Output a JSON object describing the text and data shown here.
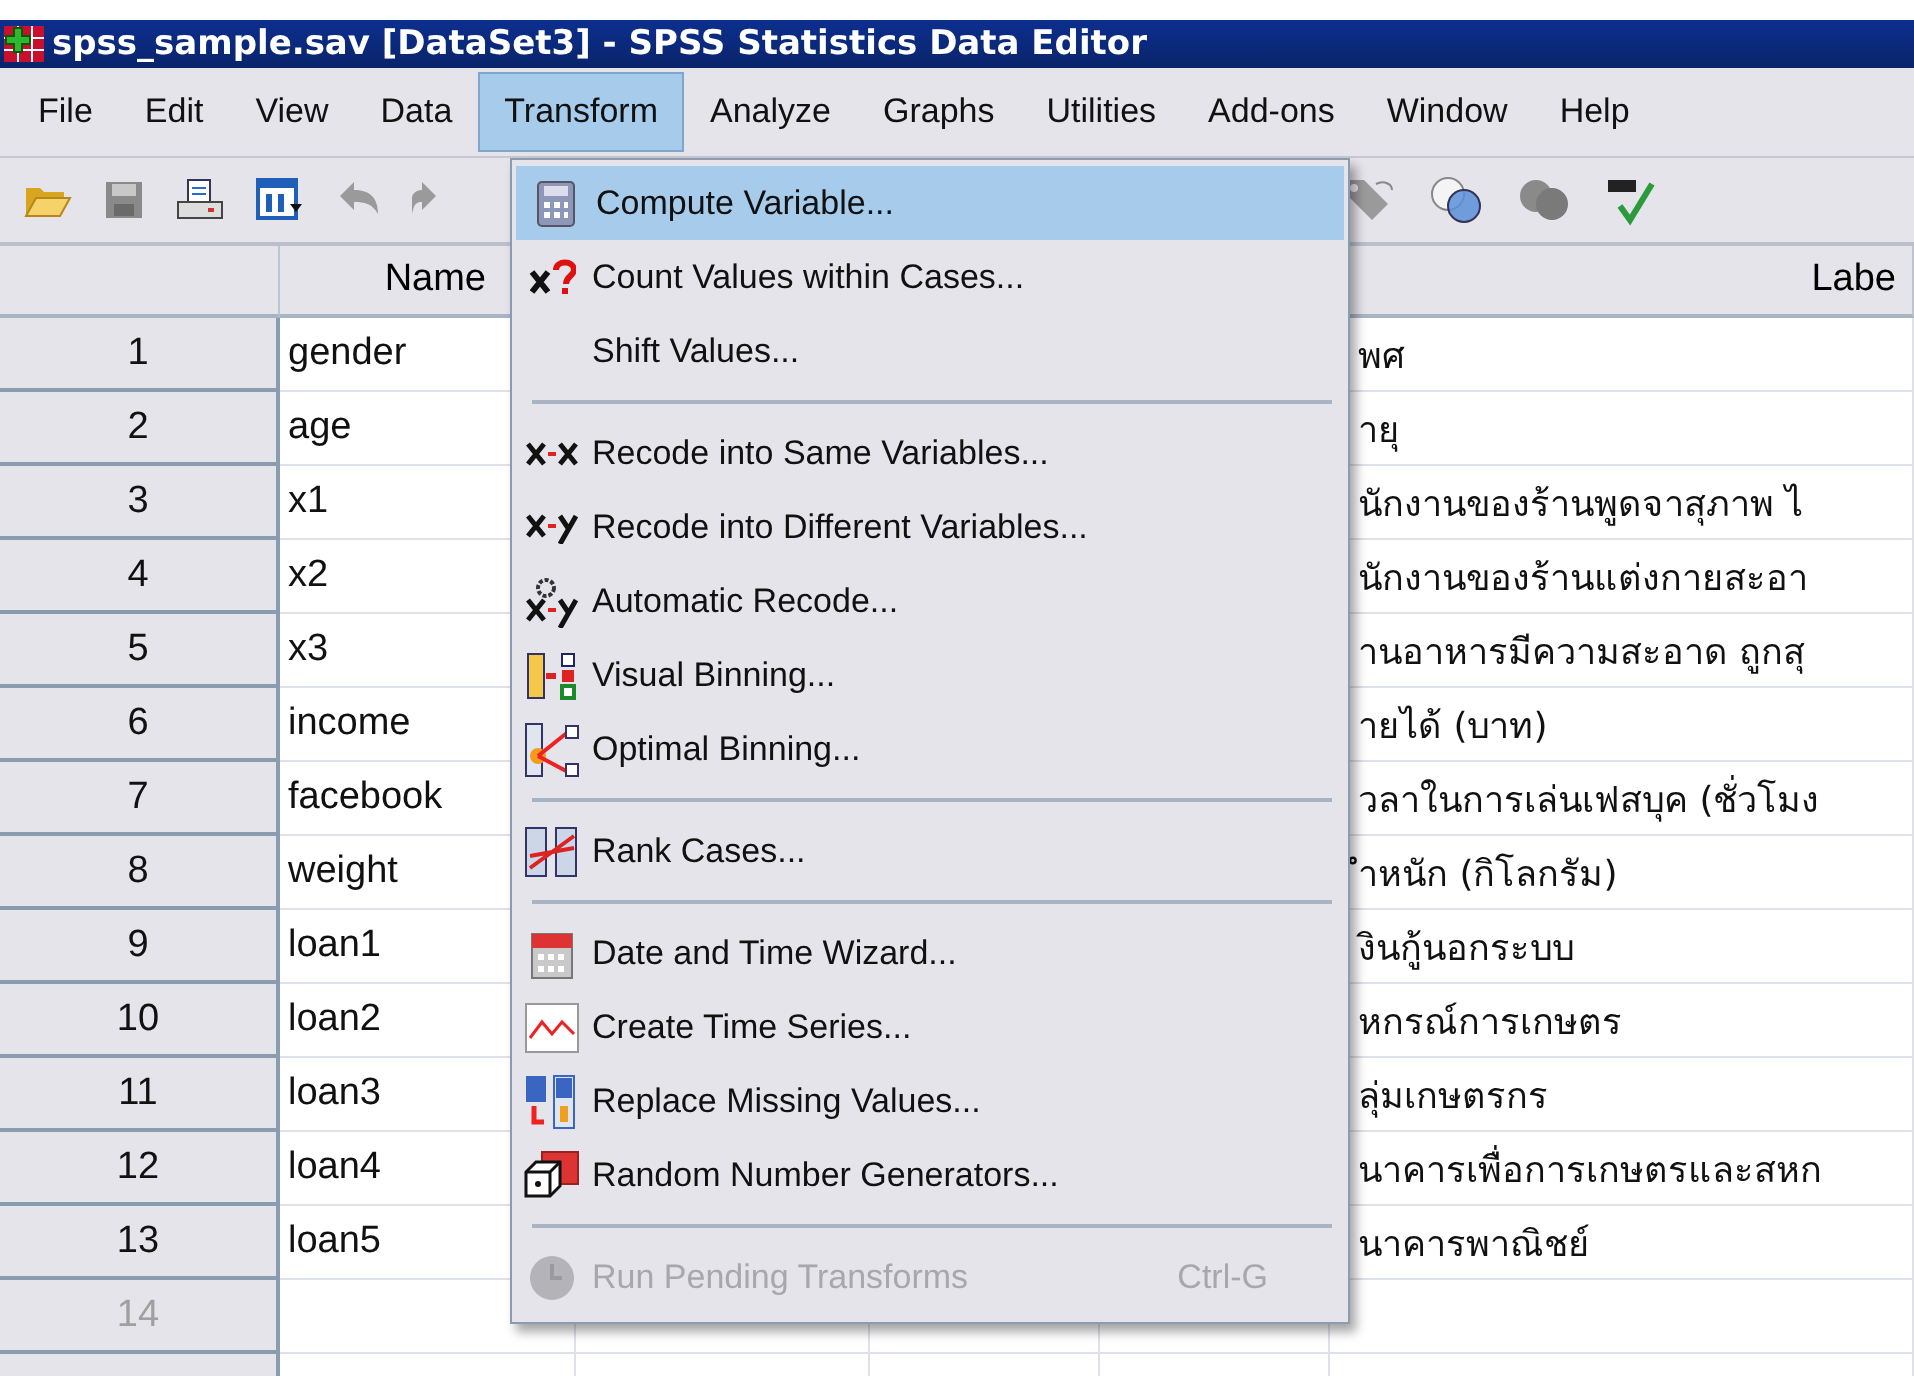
{
  "window": {
    "title": "spss_sample.sav [DataSet3] - SPSS Statistics Data Editor"
  },
  "menu_bar": [
    {
      "label": "File",
      "selected": false
    },
    {
      "label": "Edit",
      "selected": false
    },
    {
      "label": "View",
      "selected": false
    },
    {
      "label": "Data",
      "selected": false
    },
    {
      "label": "Transform",
      "selected": true
    },
    {
      "label": "Analyze",
      "selected": false
    },
    {
      "label": "Graphs",
      "selected": false
    },
    {
      "label": "Utilities",
      "selected": false
    },
    {
      "label": "Add-ons",
      "selected": false
    },
    {
      "label": "Window",
      "selected": false
    },
    {
      "label": "Help",
      "selected": false
    }
  ],
  "toolbar": {
    "left_disabled": [
      false,
      false,
      false,
      false,
      true,
      true
    ],
    "right_disabled": [
      true,
      false,
      true,
      false
    ]
  },
  "grid": {
    "columns": [
      "Name",
      "Labe"
    ],
    "rows": [
      {
        "number": "1",
        "name": "gender",
        "label": "พศ",
        "dimmed": false
      },
      {
        "number": "2",
        "name": "age",
        "label": "ายุ",
        "dimmed": false
      },
      {
        "number": "3",
        "name": "x1",
        "label": "นักงานของร้านพูดจาสุภาพ ไ",
        "dimmed": false
      },
      {
        "number": "4",
        "name": "x2",
        "label": "นักงานของร้านแต่งกายสะอา",
        "dimmed": false
      },
      {
        "number": "5",
        "name": "x3",
        "label": "านอาหารมีความสะอาด ถูกสุ",
        "dimmed": false
      },
      {
        "number": "6",
        "name": "income",
        "label": "ายได้ (บาท)",
        "dimmed": false
      },
      {
        "number": "7",
        "name": "facebook",
        "label": "วลาในการเล่นเฟสบุค (ชั่วโมง",
        "dimmed": false
      },
      {
        "number": "8",
        "name": "weight",
        "label": "ำหนัก (กิโลกรัม)",
        "dimmed": false
      },
      {
        "number": "9",
        "name": "loan1",
        "label": "งินกู้นอกระบบ",
        "dimmed": false
      },
      {
        "number": "10",
        "name": "loan2",
        "label": "หกรณ์การเกษตร",
        "dimmed": false
      },
      {
        "number": "11",
        "name": "loan3",
        "label": "ลุ่มเกษตรกร",
        "dimmed": false
      },
      {
        "number": "12",
        "name": "loan4",
        "label": "นาคารเพื่อการเกษตรและสหก",
        "dimmed": false
      },
      {
        "number": "13",
        "name": "loan5",
        "label": "นาคารพาณิชย์",
        "dimmed": false
      },
      {
        "number": "14",
        "dimmed": true
      }
    ]
  },
  "transform_menu": [
    {
      "kind": "item",
      "label": "Compute Variable...",
      "selected": true,
      "disabled": false
    },
    {
      "kind": "item",
      "label": "Count Values within Cases...",
      "selected": false,
      "disabled": false
    },
    {
      "kind": "item",
      "label": "Shift Values...",
      "selected": false,
      "disabled": false
    },
    {
      "kind": "separator"
    },
    {
      "kind": "item",
      "label": "Recode into Same Variables...",
      "selected": false,
      "disabled": false
    },
    {
      "kind": "item",
      "label": "Recode into Different Variables...",
      "selected": false,
      "disabled": false
    },
    {
      "kind": "item",
      "label": "Automatic Recode...",
      "selected": false,
      "disabled": false
    },
    {
      "kind": "item",
      "label": "Visual Binning...",
      "selected": false,
      "disabled": false
    },
    {
      "kind": "item",
      "label": "Optimal Binning...",
      "selected": false,
      "disabled": false
    },
    {
      "kind": "separator"
    },
    {
      "kind": "item",
      "label": "Rank Cases...",
      "selected": false,
      "disabled": false
    },
    {
      "kind": "separator"
    },
    {
      "kind": "item",
      "label": "Date and Time Wizard...",
      "selected": false,
      "disabled": false
    },
    {
      "kind": "item",
      "label": "Create Time Series...",
      "selected": false,
      "disabled": false
    },
    {
      "kind": "item",
      "label": "Replace Missing Values...",
      "selected": false,
      "disabled": false
    },
    {
      "kind": "item",
      "label": "Random Number Generators...",
      "selected": false,
      "disabled": false
    },
    {
      "kind": "separator"
    },
    {
      "kind": "item",
      "label": "Run Pending Transforms",
      "selected": false,
      "disabled": true,
      "shortcut": "Ctrl-G"
    }
  ]
}
